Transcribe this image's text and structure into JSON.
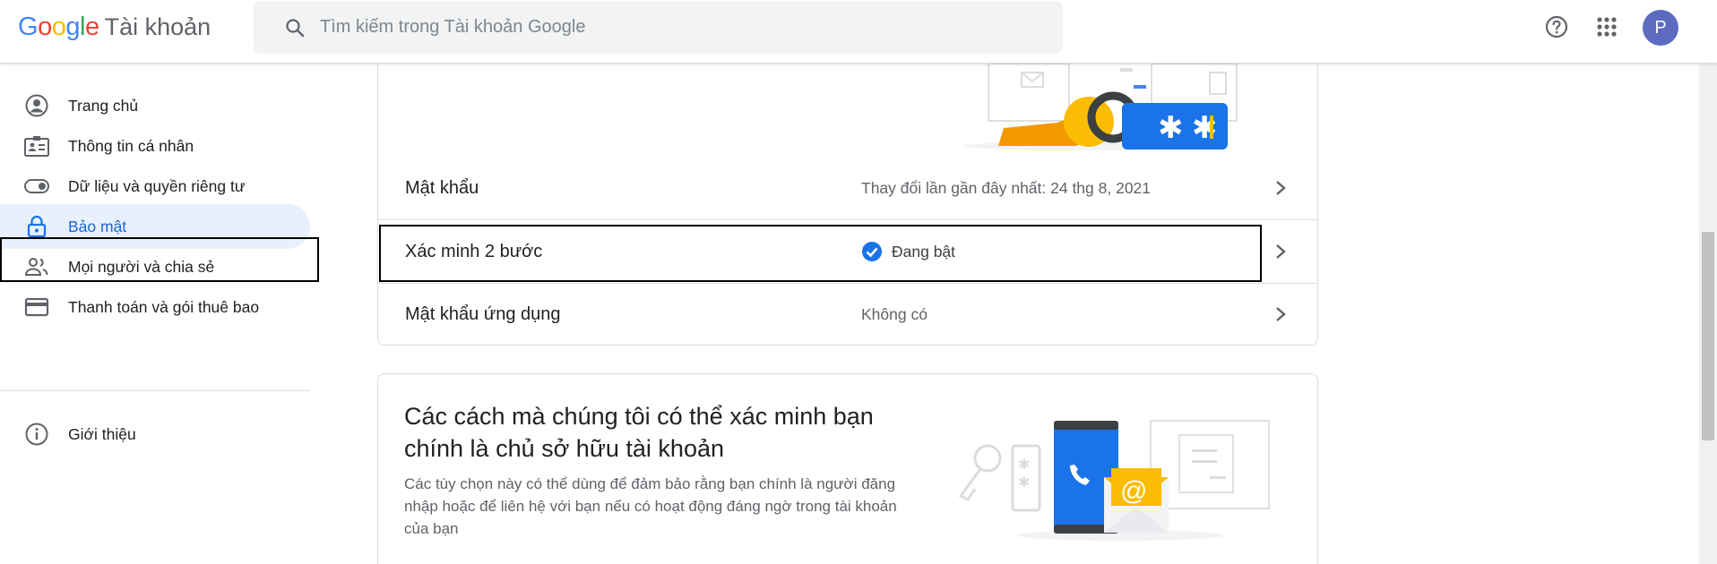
{
  "header": {
    "logo_google": "Google",
    "logo_product": "Tài khoản",
    "search_placeholder": "Tìm kiếm trong Tài khoản Google",
    "help_icon": "help-circle-icon",
    "apps_icon": "apps-grid-icon",
    "avatar_letter": "P",
    "avatar_color": "#5c6bc0"
  },
  "sidebar": {
    "items": [
      {
        "label": "Trang chủ",
        "icon": "account-circle-icon"
      },
      {
        "label": "Thông tin cá nhân",
        "icon": "id-card-icon"
      },
      {
        "label": "Dữ liệu và quyền riêng tư",
        "icon": "toggle-icon"
      },
      {
        "label": "Bảo mật",
        "icon": "lock-icon",
        "active": true
      },
      {
        "label": "Mọi người và chia sẻ",
        "icon": "people-icon"
      },
      {
        "label": "Thanh toán và gói thuê bao",
        "icon": "credit-card-icon"
      },
      {
        "label": "Giới thiệu",
        "icon": "info-icon"
      }
    ]
  },
  "signin_card": {
    "rows": [
      {
        "label": "Mật khẩu",
        "value": "Thay đổi lần gần đây nhất: 24 thg 8, 2021"
      },
      {
        "label": "Xác minh 2 bước",
        "value": "Đang bật",
        "status": "on"
      },
      {
        "label": "Mật khẩu ứng dụng",
        "value": "Không có"
      }
    ]
  },
  "verify_card": {
    "title": "Các cách mà chúng tôi có thể xác minh bạn chính là chủ sở hữu tài khoản",
    "description": "Các tùy chọn này có thể dùng để đảm bảo rằng bạn chính là người đăng nhập hoặc để liên hệ với bạn nếu có hoạt động đáng ngờ trong tài khoản của bạn"
  },
  "colors": {
    "accent_blue": "#1a73e8",
    "active_bg": "#e8f0fe",
    "active_text": "#1967d2",
    "key_yellow": "#fbbc04"
  }
}
